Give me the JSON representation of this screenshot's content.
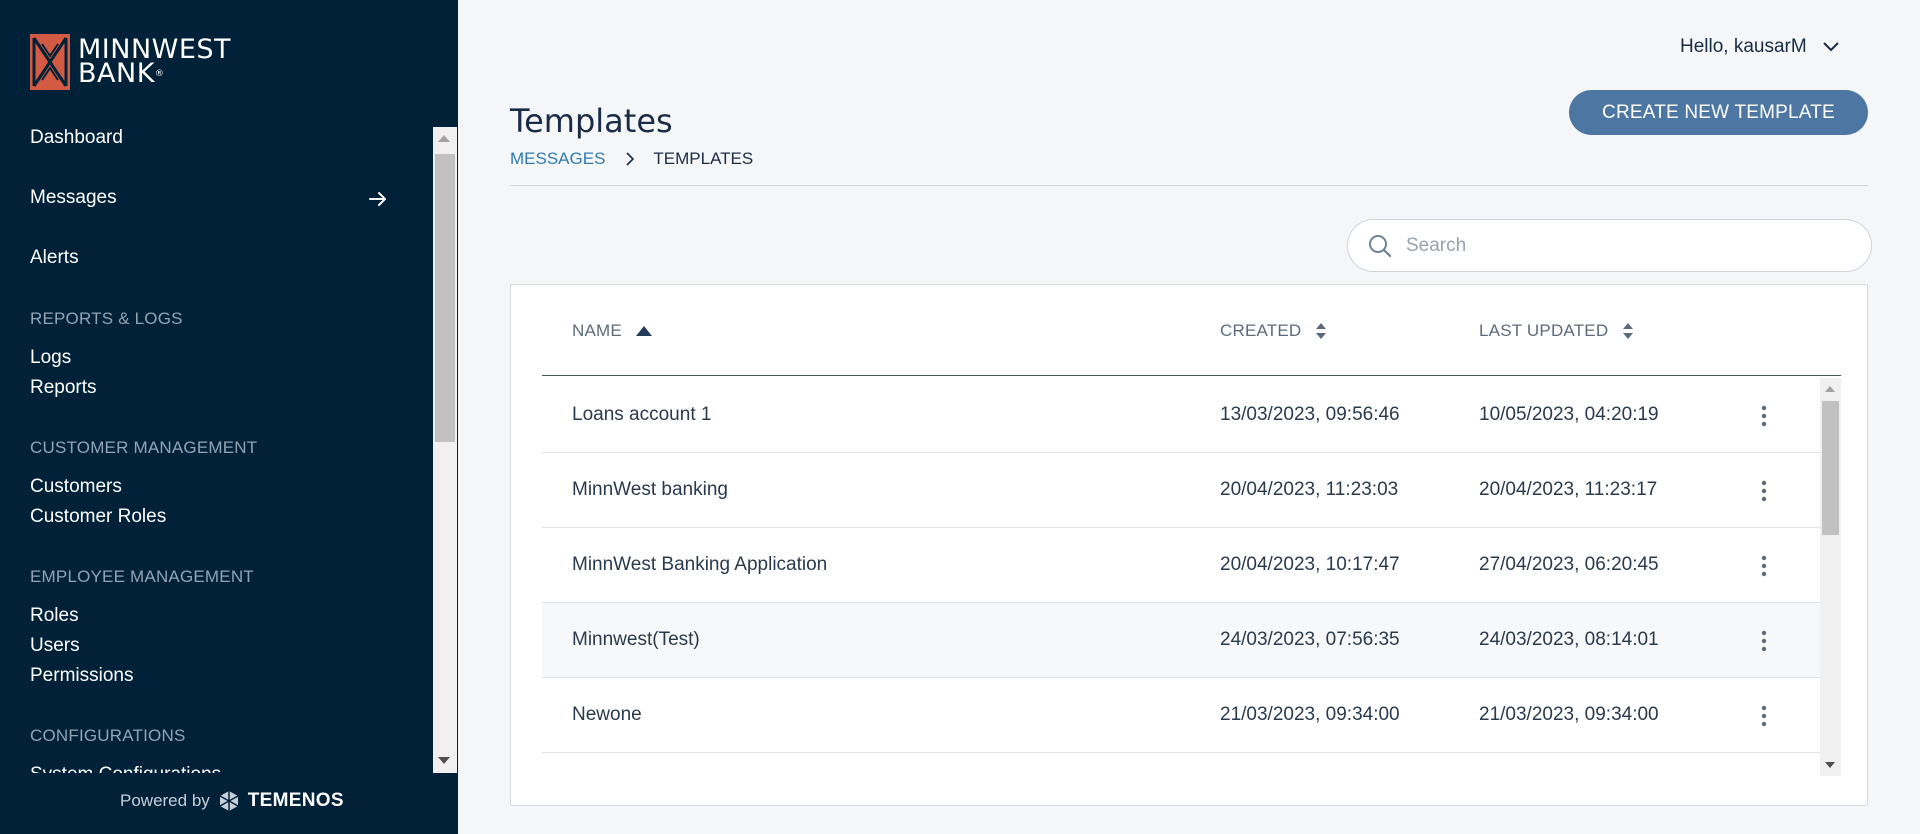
{
  "brand": {
    "logo_line1": "MINNWEST",
    "logo_line2": "BANK",
    "logo_mark": "®"
  },
  "sidebar": {
    "items": [
      {
        "label": "Dashboard"
      },
      {
        "label": "Messages"
      },
      {
        "label": "Alerts"
      }
    ],
    "sections": [
      {
        "title": "REPORTS & LOGS",
        "items": [
          "Logs",
          "Reports"
        ]
      },
      {
        "title": "CUSTOMER MANAGEMENT",
        "items": [
          "Customers",
          "Customer Roles"
        ]
      },
      {
        "title": "EMPLOYEE MANAGEMENT",
        "items": [
          "Roles",
          "Users",
          "Permissions"
        ]
      },
      {
        "title": "CONFIGURATIONS",
        "items": [
          "System Configurations"
        ]
      }
    ],
    "powered_by": "Powered by",
    "vendor": "TEMENOS"
  },
  "header": {
    "greeting": "Hello, kausarM"
  },
  "page": {
    "title": "Templates",
    "create_button": "CREATE NEW TEMPLATE",
    "breadcrumb": {
      "parent": "MESSAGES",
      "current": "TEMPLATES"
    },
    "search": {
      "placeholder": "Search",
      "value": ""
    }
  },
  "table": {
    "columns": {
      "name": "NAME",
      "created": "CREATED",
      "updated": "LAST UPDATED"
    },
    "rows": [
      {
        "name": "Loans account 1",
        "created": "13/03/2023, 09:56:46",
        "updated": "10/05/2023, 04:20:19"
      },
      {
        "name": "MinnWest banking",
        "created": "20/04/2023, 11:23:03",
        "updated": "20/04/2023, 11:23:17"
      },
      {
        "name": "MinnWest Banking Application",
        "created": "20/04/2023, 10:17:47",
        "updated": "27/04/2023, 06:20:45"
      },
      {
        "name": "Minnwest(Test)",
        "created": "24/03/2023, 07:56:35",
        "updated": "24/03/2023, 08:14:01"
      },
      {
        "name": "Newone",
        "created": "21/03/2023, 09:34:00",
        "updated": "21/03/2023, 09:34:00"
      }
    ]
  },
  "colors": {
    "sidebar_bg": "#002138",
    "accent_button": "#4d76a2",
    "link": "#2e7cae",
    "logo": "#d35a43"
  }
}
